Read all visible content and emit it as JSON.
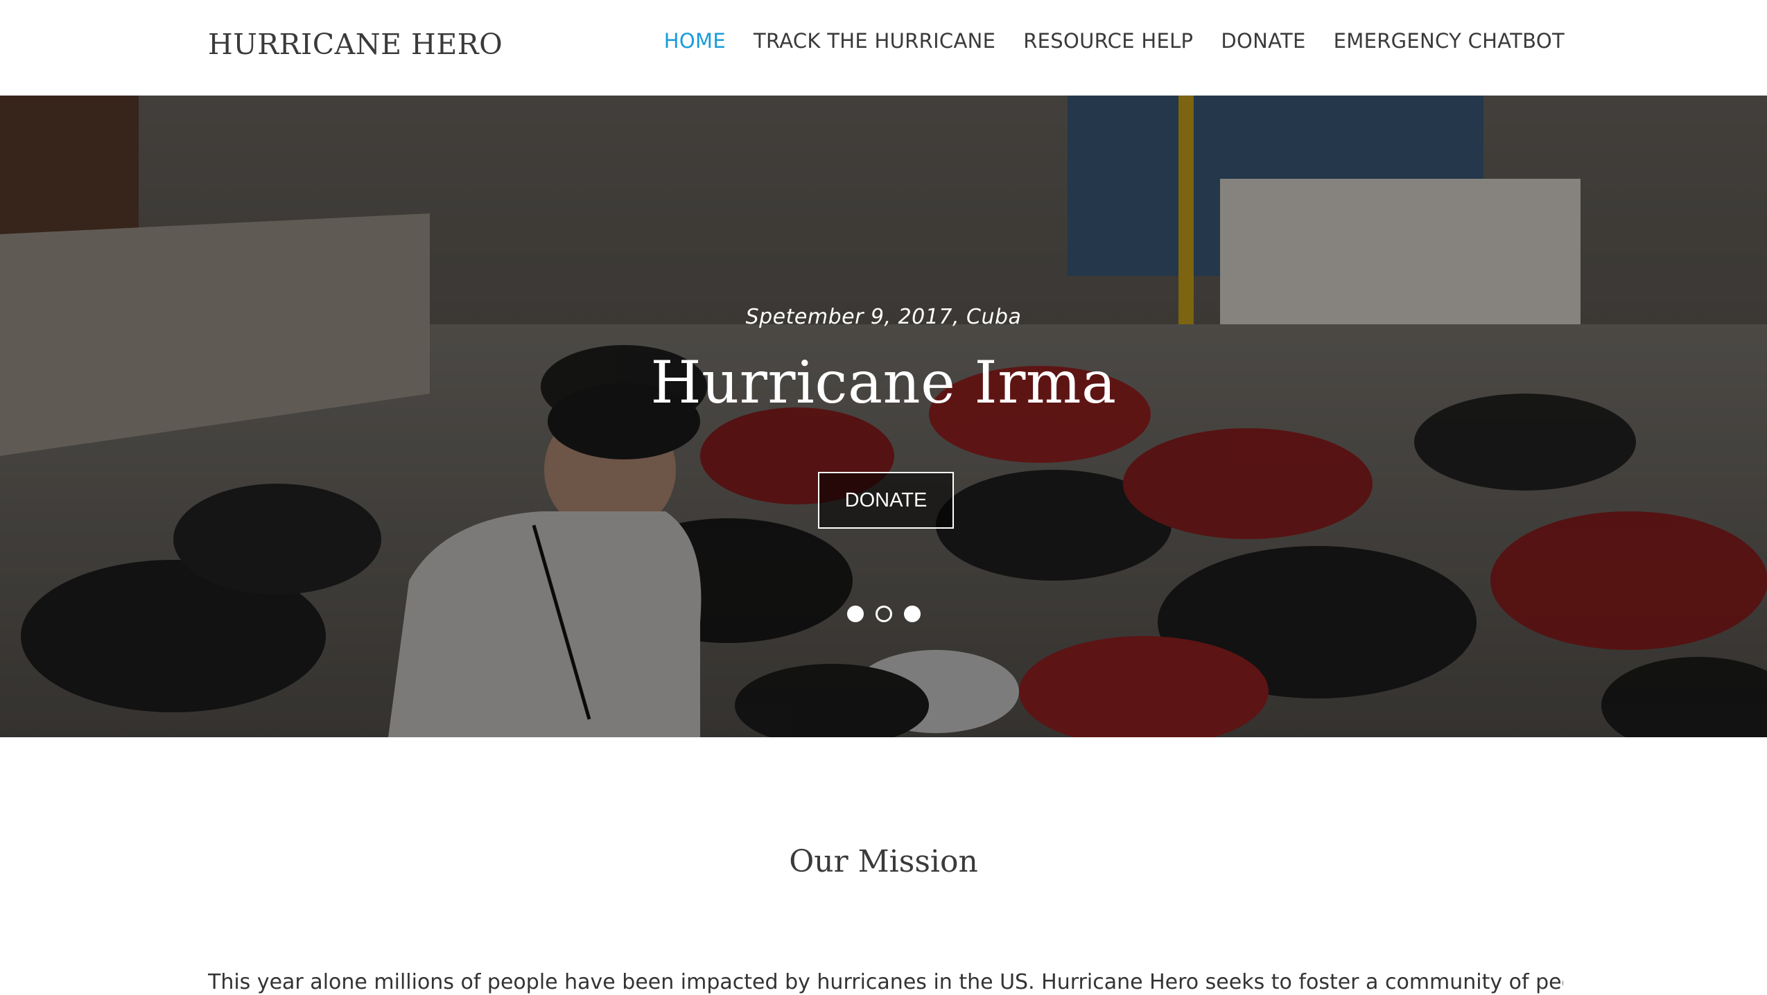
{
  "brand": "HURRICANE HERO",
  "nav": {
    "items": [
      {
        "label": "HOME",
        "active": true
      },
      {
        "label": "TRACK THE HURRICANE",
        "active": false
      },
      {
        "label": "RESOURCE HELP",
        "active": false
      },
      {
        "label": "DONATE",
        "active": false
      },
      {
        "label": "EMERGENCY CHATBOT",
        "active": false
      }
    ]
  },
  "hero": {
    "date": "Spetember 9, 2017, Cuba",
    "title": "Hurricane Irma",
    "button_label": "DONATE",
    "slides": 3,
    "active_slide": 2
  },
  "mission": {
    "title": "Our Mission",
    "text": "This year alone millions of people have been impacted by hurricanes in the US. Hurricane Hero seeks to foster a community of people"
  },
  "colors": {
    "accent": "#1a9bdb",
    "text": "#3a3a3a"
  }
}
